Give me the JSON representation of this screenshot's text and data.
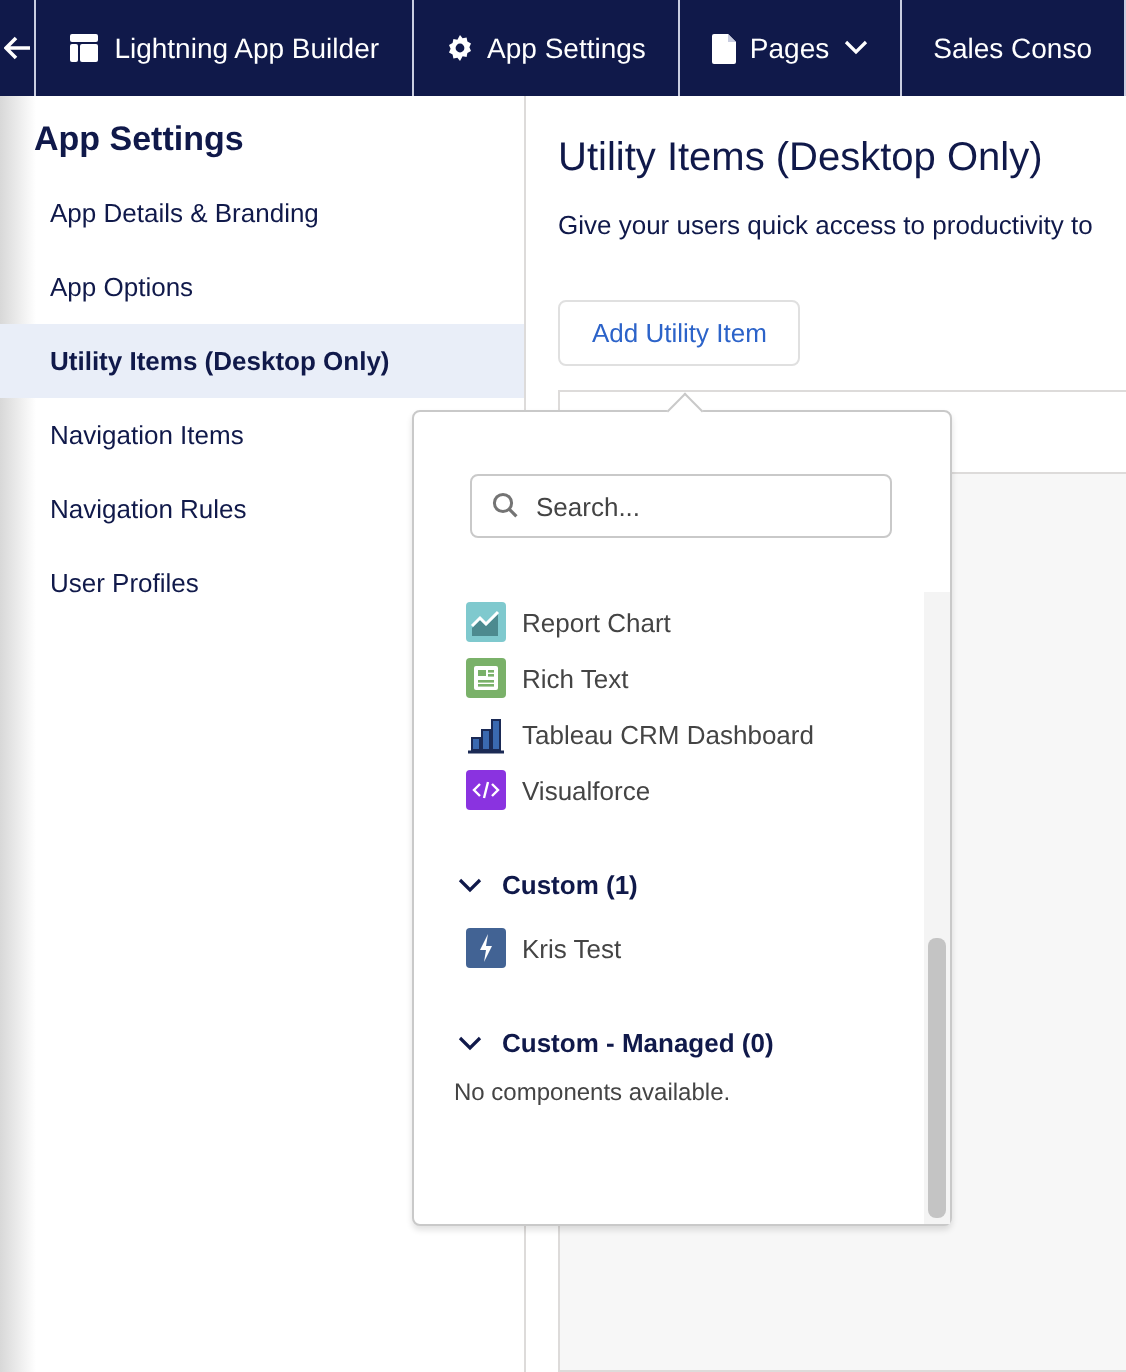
{
  "top_bar": {
    "tabs": [
      {
        "label": "Lightning App Builder",
        "kind": "layout",
        "dropdown": false
      },
      {
        "label": "App Settings",
        "kind": "gear",
        "dropdown": false
      },
      {
        "label": "Pages",
        "kind": "page",
        "dropdown": true
      },
      {
        "label": "Sales Conso",
        "kind": "plain",
        "dropdown": false
      }
    ]
  },
  "sidebar": {
    "title": "App Settings",
    "items": [
      {
        "label": "App Details & Branding",
        "selected": false
      },
      {
        "label": "App Options",
        "selected": false
      },
      {
        "label": "Utility Items (Desktop Only)",
        "selected": true
      },
      {
        "label": "Navigation Items",
        "selected": false
      },
      {
        "label": "Navigation Rules",
        "selected": false
      },
      {
        "label": "User Profiles",
        "selected": false
      }
    ]
  },
  "main": {
    "title": "Utility Items (Desktop Only)",
    "description": "Give your users quick access to productivity to",
    "add_button": "Add Utility Item"
  },
  "popover": {
    "search": {
      "placeholder": "Search..."
    },
    "items": [
      {
        "label": "Report Chart",
        "kind": "chart"
      },
      {
        "label": "Rich Text",
        "kind": "richtext"
      },
      {
        "label": "Tableau CRM Dashboard",
        "kind": "tableau"
      },
      {
        "label": "Visualforce",
        "kind": "visualforce"
      }
    ],
    "sections": [
      {
        "title": "Custom (1)",
        "expanded": true,
        "items": [
          {
            "label": "Kris Test",
            "kind": "lightning"
          }
        ]
      },
      {
        "title": "Custom - Managed (0)",
        "expanded": true,
        "empty_text": "No components available."
      }
    ]
  }
}
